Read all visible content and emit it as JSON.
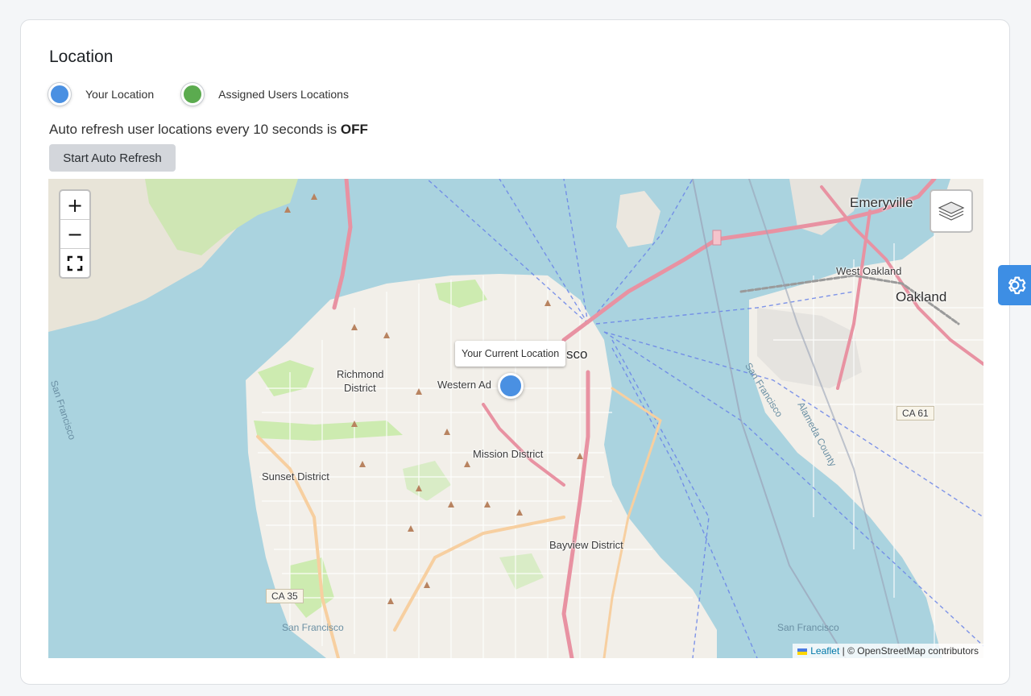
{
  "page": {
    "title": "Location"
  },
  "legend": {
    "items": [
      {
        "label": "Your Location",
        "color": "#4a90e2"
      },
      {
        "label": "Assigned Users Locations",
        "color": "#5bab4f"
      }
    ]
  },
  "refresh": {
    "text": "Auto refresh user locations every 10 seconds is ",
    "status": "OFF",
    "button_label": "Start Auto Refresh"
  },
  "map": {
    "zoom_in": "+",
    "zoom_out": "−",
    "marker_tooltip": "Your Current Location",
    "attribution_link": "Leaflet",
    "attribution_text": " | © OpenStreetMap contributors",
    "labels": {
      "emeryville": "Emeryville",
      "west_oakland": "West Oakland",
      "oakland": "Oakland",
      "richmond": "Richmond",
      "richmond_district": "District",
      "western_addition": "Western Ad",
      "sf_partial": "sco",
      "mission": "Mission District",
      "sunset": "Sunset District",
      "bayview": "Bayview District",
      "ca61": "CA 61",
      "ca35": "CA 35",
      "sf_water_left": "San Francisco",
      "sf_water_mid": "San Francisco",
      "sf_bottom_left": "San Francisco",
      "sf_bottom_right": "San Francisco",
      "alameda": "Alameda County"
    },
    "icons": {
      "layers": "layers-icon",
      "fullscreen": "fullscreen-icon",
      "settings": "gear-icon"
    }
  },
  "colors": {
    "accent": "#3d8ee4",
    "water": "#aad3df",
    "land": "#f2efe9",
    "park": "#cdebb0"
  }
}
